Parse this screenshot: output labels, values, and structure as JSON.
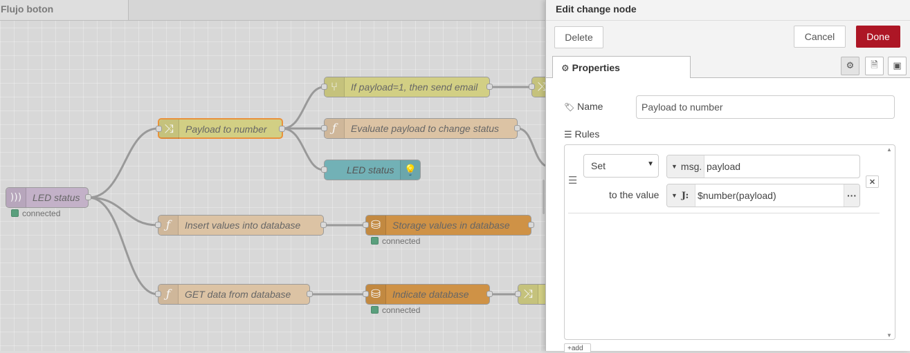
{
  "workspace": {
    "tab_label": "Flujo boton",
    "nodes": {
      "led_status_ws": {
        "label": "LED status",
        "status": "connected"
      },
      "payload_to_number": {
        "label": "Payload to number"
      },
      "if_payload": {
        "label": "If payload=1, then send email"
      },
      "evaluate_payload": {
        "label": "Evaluate payload to change status"
      },
      "led_status_out": {
        "label": "LED status"
      },
      "insert_values": {
        "label": "Insert values into database"
      },
      "storage_values": {
        "label": "Storage values in database",
        "status": "connected"
      },
      "get_data": {
        "label": "GET data from database"
      },
      "indicate_db": {
        "label": "Indicate database",
        "status": "connected"
      }
    },
    "colors": {
      "change": "#d2cf84",
      "function": "#dcc3a4",
      "ui_led": "#72b1b6",
      "websocket": "#c3b1c8",
      "database": "#cf9246",
      "status_connected": "#5a9f7d"
    }
  },
  "tray": {
    "title": "Edit change node",
    "delete_label": "Delete",
    "cancel_label": "Cancel",
    "done_label": "Done",
    "properties_tab": "Properties",
    "name_label": "Name",
    "name_value": "Payload to number",
    "rules_label": "Rules",
    "rule": {
      "action": "Set",
      "target_type": "msg.",
      "target_value": "payload",
      "to_label": "to the value",
      "value_type_icon": "J:",
      "value": "$number(payload)"
    },
    "add_label": "add",
    "accent_color": "#ad1625"
  }
}
